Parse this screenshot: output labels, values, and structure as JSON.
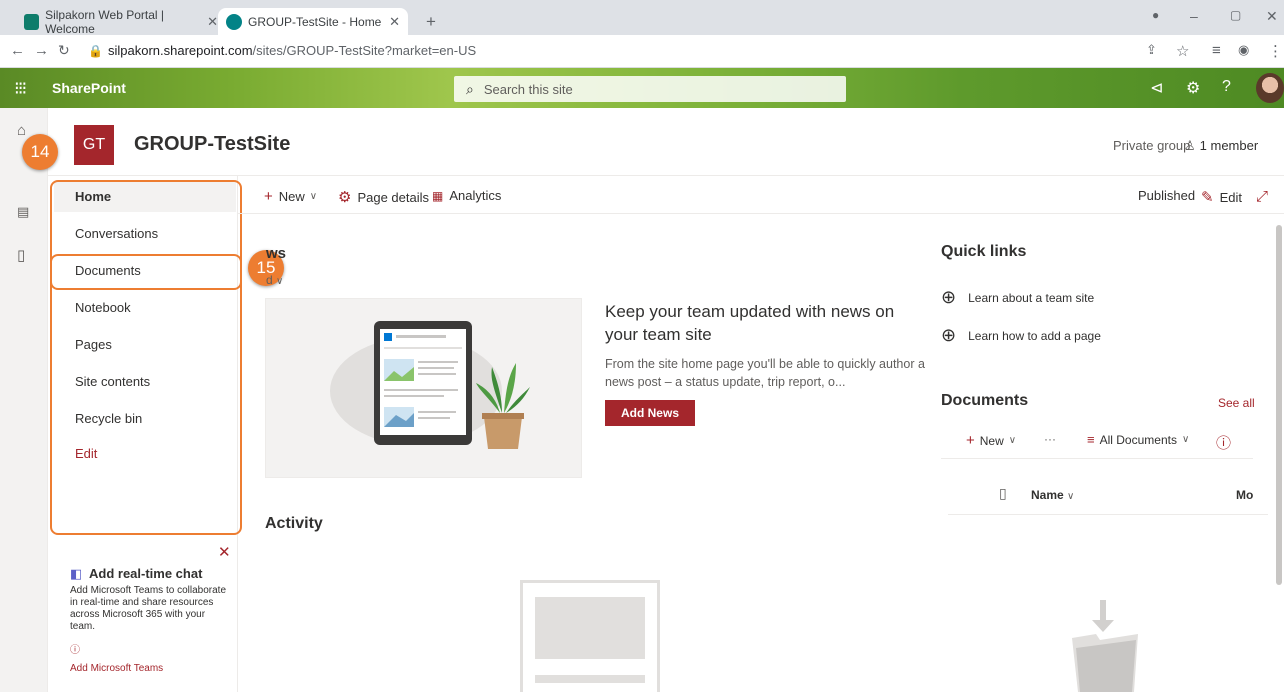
{
  "browser": {
    "tabs": [
      {
        "title": "Silpakorn Web Portal | Welcome",
        "active": false
      },
      {
        "title": "GROUP-TestSite - Home",
        "active": true
      }
    ],
    "new_tab": "+",
    "url_host": "silpakorn.sharepoint.com",
    "url_path": "/sites/GROUP-TestSite?market=en-US"
  },
  "suite": {
    "app_name": "SharePoint",
    "search_placeholder": "Search this site"
  },
  "site": {
    "logo_initials": "GT",
    "title": "GROUP-TestSite",
    "privacy": "Private group",
    "members": "1 member"
  },
  "nav": {
    "items": [
      "Home",
      "Conversations",
      "Documents",
      "Notebook",
      "Pages",
      "Site contents",
      "Recycle bin"
    ],
    "edit": "Edit"
  },
  "callouts": {
    "a": "14",
    "b": "15"
  },
  "commandbar": {
    "new": "New",
    "page_details": "Page details",
    "analytics": "Analytics",
    "published": "Published",
    "edit": "Edit"
  },
  "news": {
    "title": "ws",
    "subtitle": "d",
    "heading": "Keep your team updated with news on your team site",
    "description": "From the site home page you'll be able to quickly author a news post – a status update, trip report, o...",
    "add_button": "Add News"
  },
  "activity": {
    "title": "Activity"
  },
  "quick_links": {
    "title": "Quick links",
    "items": [
      "Learn about a team site",
      "Learn how to add a page"
    ]
  },
  "documents": {
    "title": "Documents",
    "see_all": "See all",
    "new": "New",
    "more": "···",
    "view": "All Documents",
    "col_name": "Name",
    "col_modified": "Mo"
  },
  "teams_promo": {
    "title": "Add real-time chat",
    "body": "Add Microsoft Teams to collaborate in real-time and share resources across Microsoft 365 with your team.",
    "link": "Add Microsoft Teams"
  },
  "colors": {
    "accent": "#a4262c",
    "callout": "#ed7d31",
    "suitebar": "#79ab31"
  }
}
